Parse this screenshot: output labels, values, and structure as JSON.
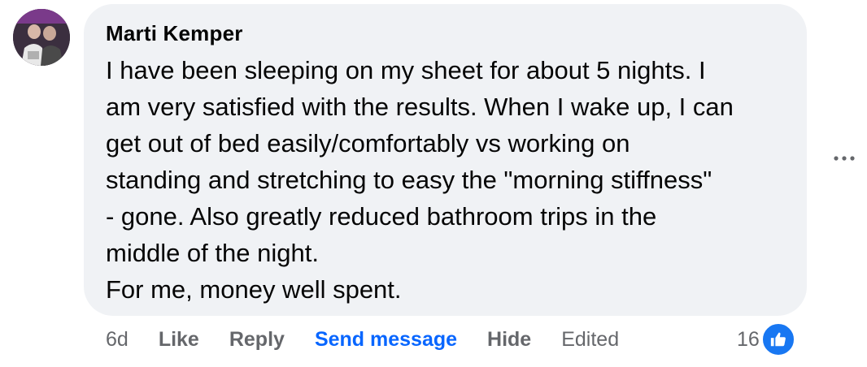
{
  "comment": {
    "author": "Marti Kemper",
    "body_lines": [
      "I have been sleeping on my sheet for about 5 nights. I",
      "am very satisfied with the results. When I wake up, I can",
      "get out of bed easily/comfortably vs working on",
      "standing and stretching to easy the \"morning stiffness\"",
      "- gone. Also greatly reduced bathroom trips in the",
      "middle of the night.",
      "For me, money well spent."
    ],
    "time": "6d",
    "like_label": "Like",
    "reply_label": "Reply",
    "send_message_label": "Send message",
    "hide_label": "Hide",
    "edited_label": "Edited",
    "reaction_count": "16",
    "reaction_icon": "thumbs-up-icon",
    "more_icon": "more-options-icon"
  },
  "colors": {
    "bubble_bg": "#f0f2f5",
    "text": "#050505",
    "muted": "#65676b",
    "link_blue": "#0866ff",
    "like_blue": "#1877f2"
  }
}
